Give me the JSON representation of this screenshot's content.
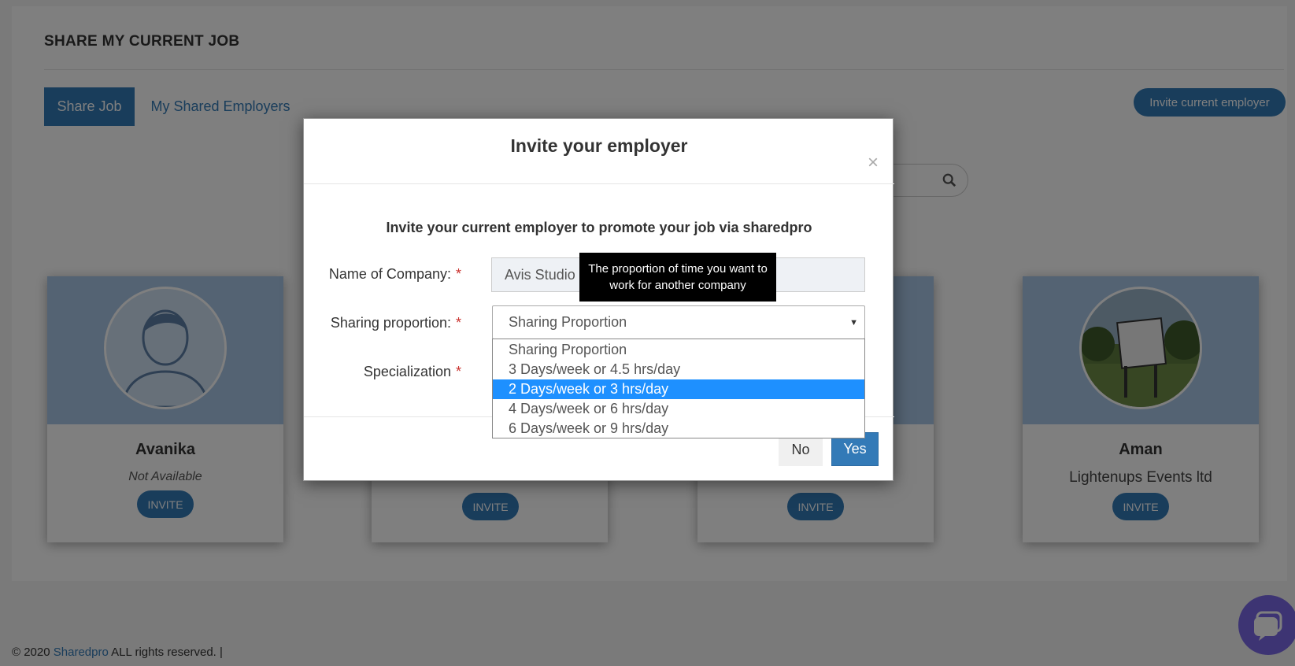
{
  "page": {
    "title": "SHARE MY CURRENT JOB",
    "tabs": [
      {
        "label": "Share Job",
        "active": true
      },
      {
        "label": "My Shared Employers",
        "active": false
      }
    ],
    "invite_current_label": "Invite current employer"
  },
  "cards": [
    {
      "name": "Avanika",
      "subtitle": "Not Available",
      "button": "INVITE",
      "avatar": "default-user-avatar"
    },
    {
      "name": "",
      "subtitle": "",
      "button": "INVITE",
      "avatar": "hidden"
    },
    {
      "name": "",
      "subtitle": "",
      "button": "INVITE",
      "avatar": "hidden"
    },
    {
      "name": "Aman",
      "subtitle": "Lightenups Events ltd",
      "button": "INVITE",
      "avatar": "now-hiring-sign-photo"
    }
  ],
  "footer": {
    "prefix": "© 2020 ",
    "brand": "Sharedpro",
    "suffix": " ALL rights reserved.  |"
  },
  "modal": {
    "title": "Invite your employer",
    "close_glyph": "×",
    "subtitle": "Invite your current employer to promote your job via sharedpro",
    "fields": {
      "company_label": "Name of Company:",
      "company_value": "Avis Studio",
      "sharing_label": "Sharing proportion:",
      "sharing_value": "Sharing Proportion",
      "specialization_label": "Specialization",
      "required_mark": "*"
    },
    "dropdown_options": [
      "Sharing Proportion",
      "3 Days/week or 4.5 hrs/day",
      "2 Days/week or 3 hrs/day",
      "4 Days/week or 6 hrs/day",
      "6 Days/week or 9 hrs/day"
    ],
    "highlighted_option_index": 2,
    "no_label": "No",
    "yes_label": "Yes"
  },
  "tooltip": {
    "text": "The proportion of time you want to work for another company"
  },
  "colors": {
    "primary": "#337ab7",
    "highlight": "#1e90ff",
    "required": "#c9302c",
    "chat": "#7a68e6"
  }
}
